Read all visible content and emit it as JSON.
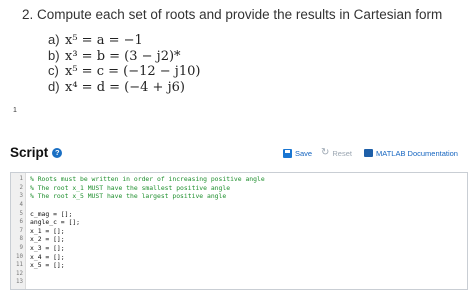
{
  "problem": {
    "title": "2.  Compute each set of roots and provide the results in Cartesian form",
    "parts": [
      {
        "letter": "a)",
        "expr": "x⁵ = a = −1"
      },
      {
        "letter": "b)",
        "expr": "x³ = b = (3 − j2)*"
      },
      {
        "letter": "c)",
        "expr": "x⁵ = c = (−12 − j10)"
      },
      {
        "letter": "d)",
        "expr": "x⁴ = d = (−4 + j6)"
      }
    ]
  },
  "page_marker": "1",
  "script": {
    "heading": "Script",
    "help_icon": "?",
    "save_label": "Save",
    "reset_label": "Reset",
    "doc_label": "MATLAB Documentation"
  },
  "editor": {
    "lines": [
      {
        "num": "1",
        "text": "% Roots must be written in order of increasing positive angle",
        "type": "comment"
      },
      {
        "num": "2",
        "text": "% The root x_1 MUST have the smallest positive angle",
        "type": "comment"
      },
      {
        "num": "3",
        "text": "% The root x_5 MUST have the largest positive angle",
        "type": "comment"
      },
      {
        "num": "4",
        "text": "",
        "type": "code"
      },
      {
        "num": "5",
        "text": "c_mag = [];",
        "type": "code"
      },
      {
        "num": "6",
        "text": "angle_c = [];",
        "type": "code"
      },
      {
        "num": "7",
        "text": "x_1 = [];",
        "type": "code"
      },
      {
        "num": "8",
        "text": "x_2 = [];",
        "type": "code"
      },
      {
        "num": "9",
        "text": "x_3 = [];",
        "type": "code"
      },
      {
        "num": "10",
        "text": "x_4 = [];",
        "type": "code"
      },
      {
        "num": "11",
        "text": "x_5 = [];",
        "type": "code"
      },
      {
        "num": "12",
        "text": "",
        "type": "code"
      },
      {
        "num": "13",
        "text": "",
        "type": "code"
      }
    ]
  },
  "colors": {
    "accent": "#1565c0",
    "comment": "#1e8f2d",
    "disabled": "#9aa5b1"
  }
}
